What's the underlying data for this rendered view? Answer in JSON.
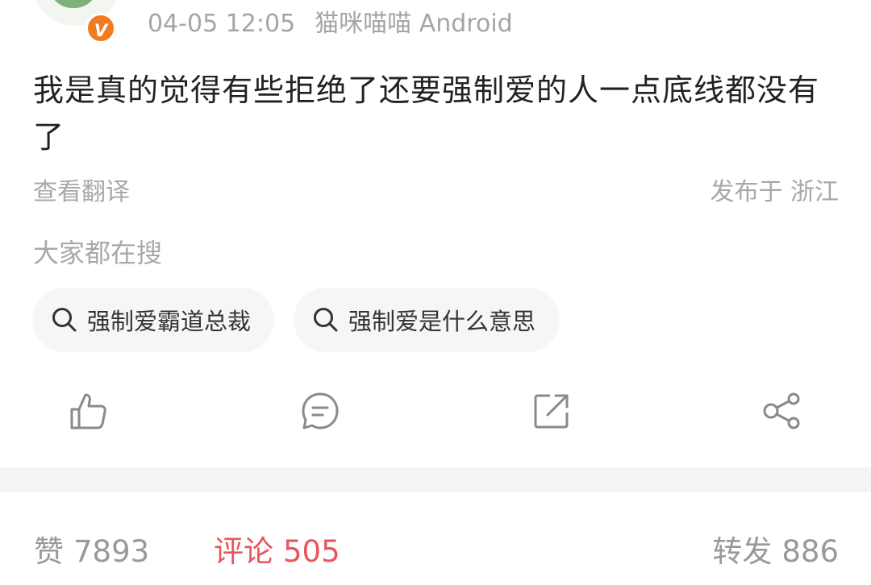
{
  "post": {
    "author": {
      "verified_badge": "V"
    },
    "timestamp": "04-05 12:05",
    "source": "猫咪喵喵 Android",
    "text": "我是真的觉得有些拒绝了还要强制爱的人一点底线都没有了",
    "translate_label": "查看翻译",
    "location": "发布于 浙江"
  },
  "trending": {
    "title": "大家都在搜",
    "chips": [
      {
        "label": "强制爱霸道总裁",
        "icon": "search-icon"
      },
      {
        "label": "强制爱是什么意思",
        "icon": "search-icon"
      }
    ]
  },
  "actions": [
    {
      "icon": "like-icon"
    },
    {
      "icon": "comment-icon"
    },
    {
      "icon": "repost-icon"
    },
    {
      "icon": "share-icon"
    }
  ],
  "stats": {
    "likes_label": "赞",
    "likes_count": "7893",
    "comments_label": "评论",
    "comments_count": "505",
    "reposts_label": "转发",
    "reposts_count": "886"
  },
  "colors": {
    "accent_red": "#e8565c",
    "badge_orange": "#f07c22",
    "muted_gray": "#a8a8a8"
  }
}
